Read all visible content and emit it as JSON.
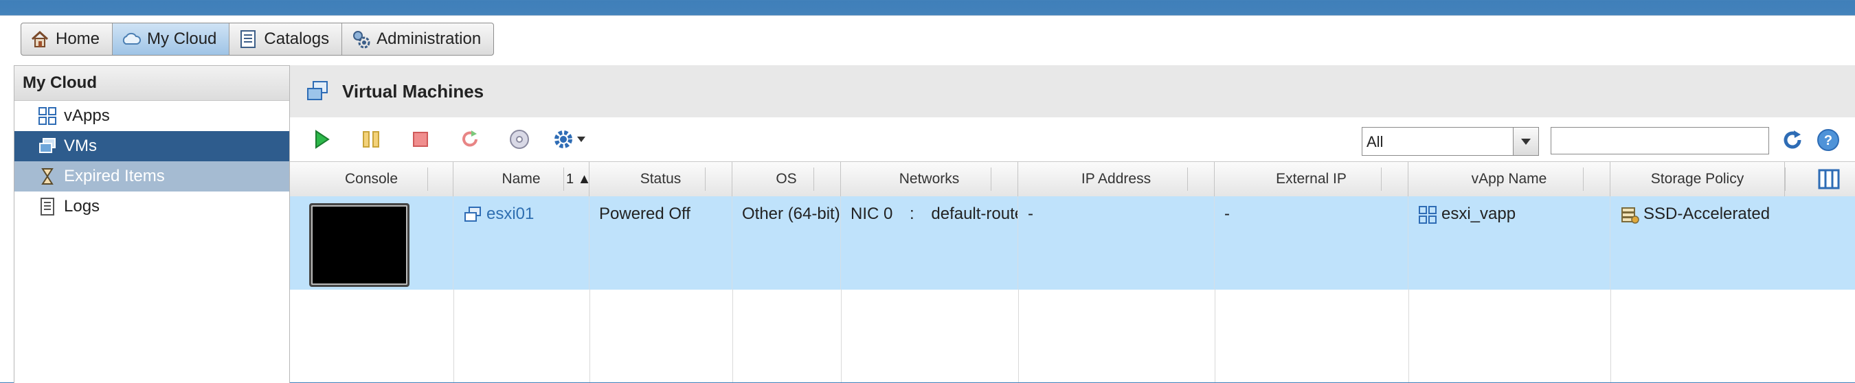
{
  "nav": {
    "tabs": [
      {
        "label": "Home",
        "icon": "home-icon"
      },
      {
        "label": "My Cloud",
        "icon": "cloud-icon"
      },
      {
        "label": "Catalogs",
        "icon": "catalog-icon"
      },
      {
        "label": "Administration",
        "icon": "administration-icon"
      }
    ],
    "active_tab": "My Cloud"
  },
  "sidebar": {
    "title": "My Cloud",
    "items": [
      {
        "label": "vApps",
        "icon": "vapp-icon"
      },
      {
        "label": "VMs",
        "icon": "vm-icon",
        "selected": true
      },
      {
        "label": "Expired Items",
        "icon": "hourglass-icon"
      },
      {
        "label": "Logs",
        "icon": "log-icon"
      }
    ]
  },
  "main": {
    "title": "Virtual Machines",
    "filter": {
      "value": "All"
    },
    "search": {
      "placeholder": ""
    }
  },
  "table": {
    "columns": [
      "Console",
      "Name",
      "Status",
      "OS",
      "Networks",
      "IP Address",
      "External IP",
      "vApp Name",
      "Storage Policy"
    ],
    "sort_indicator": "1 ▲",
    "rows": [
      {
        "name": "esxi01",
        "status": "Powered Off",
        "os": "Other (64-bit)",
        "network_nic": "NIC 0",
        "network_sep": ":",
        "network_name": "default-routed-network",
        "ip_address": "-",
        "external_ip": "-",
        "vapp_name": "esxi_vapp",
        "storage_policy": "SSD-Accelerated"
      }
    ]
  },
  "colors": {
    "selected_nav": "#2e5c8d",
    "row_highlight": "#bfe2fb",
    "link": "#2f6fb1"
  }
}
